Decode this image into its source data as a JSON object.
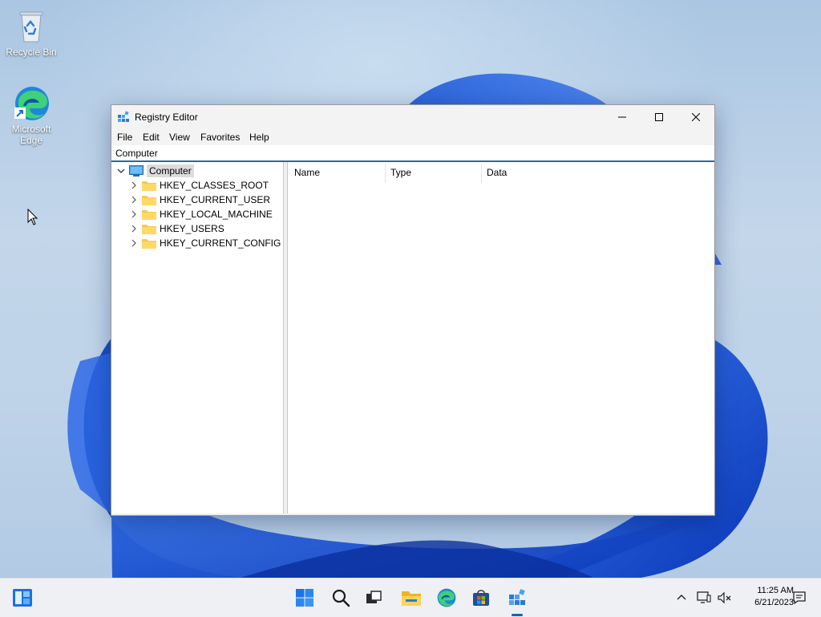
{
  "desktop": {
    "icons": [
      {
        "label": "Recycle Bin",
        "icon": "recycle-bin-icon"
      },
      {
        "label": "Microsoft Edge",
        "icon": "edge-icon"
      }
    ]
  },
  "window": {
    "title": "Registry Editor",
    "icon": "regedit-icon",
    "controls": {
      "minimize": "minimize-icon",
      "maximize": "maximize-icon",
      "close": "close-icon"
    }
  },
  "menu": [
    "File",
    "Edit",
    "View",
    "Favorites",
    "Help"
  ],
  "address": "Computer",
  "tree": {
    "root": "Computer",
    "children": [
      "HKEY_CLASSES_ROOT",
      "HKEY_CURRENT_USER",
      "HKEY_LOCAL_MACHINE",
      "HKEY_USERS",
      "HKEY_CURRENT_CONFIG"
    ]
  },
  "list": {
    "columns": [
      "Name",
      "Type",
      "Data"
    ],
    "rows": []
  },
  "taskbar": {
    "items": [
      "widgets-icon",
      "start-icon",
      "search-icon",
      "task-view-icon",
      "file-explorer-icon",
      "edge-icon",
      "store-icon",
      "regedit-icon"
    ],
    "tray": [
      "chevron-up-icon",
      "network-icon",
      "volume-muted-icon",
      "notifications-icon"
    ],
    "clock": {
      "time": "11:25 AM",
      "date": "6/21/2023"
    }
  },
  "colors": {
    "accent": "#0067c0",
    "selection": "#dcdcdc",
    "address_border": "#2c6a96"
  }
}
